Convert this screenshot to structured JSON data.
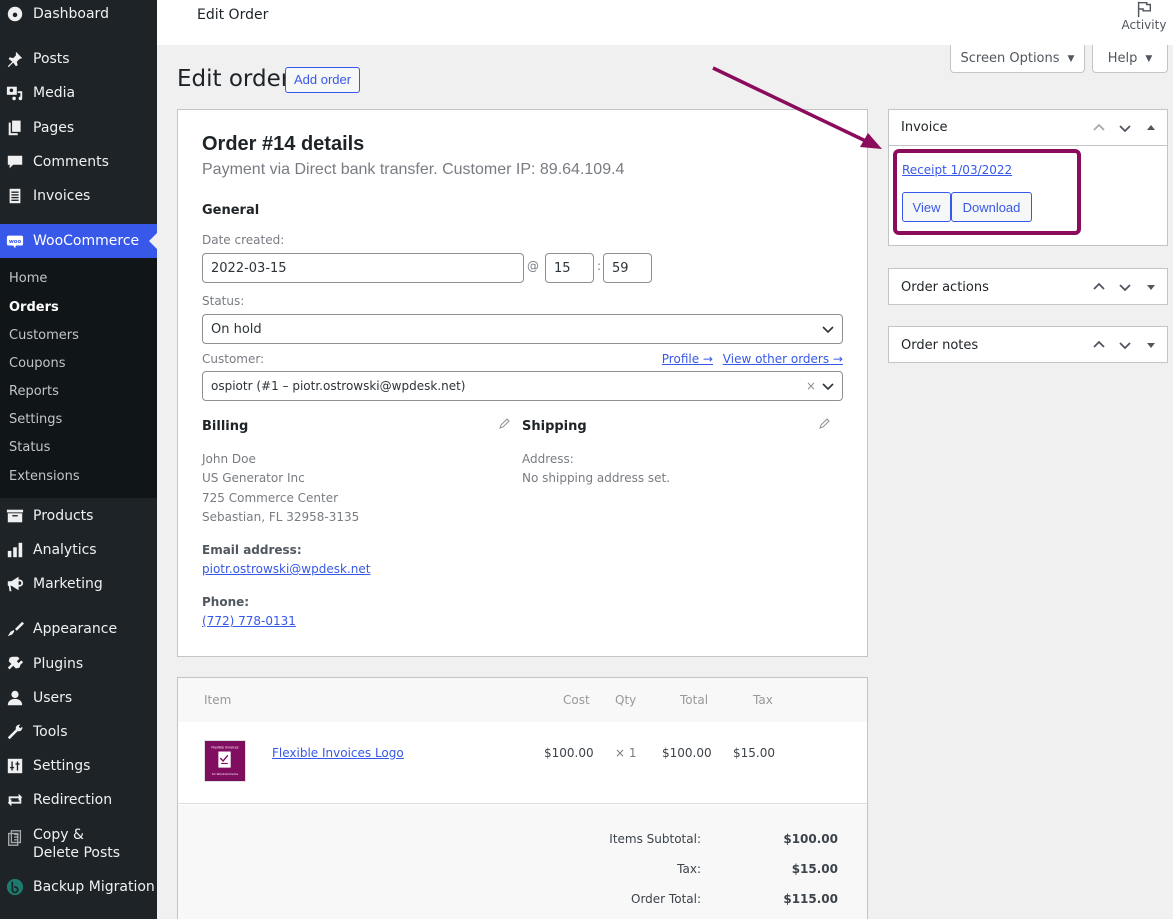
{
  "sidebar": {
    "top_items": [
      {
        "label": "Dashboard",
        "icon": "dashboard-icon"
      },
      {
        "label": "Posts",
        "icon": "pin-icon"
      },
      {
        "label": "Media",
        "icon": "media-icon"
      },
      {
        "label": "Pages",
        "icon": "pages-icon"
      },
      {
        "label": "Comments",
        "icon": "comment-icon"
      },
      {
        "label": "Invoices",
        "icon": "invoice-icon"
      },
      {
        "label": "WooCommerce",
        "icon": "woo-icon"
      }
    ],
    "woo_submenu": [
      {
        "label": "Home"
      },
      {
        "label": "Orders",
        "current": true
      },
      {
        "label": "Customers"
      },
      {
        "label": "Coupons"
      },
      {
        "label": "Reports"
      },
      {
        "label": "Settings"
      },
      {
        "label": "Status"
      },
      {
        "label": "Extensions"
      }
    ],
    "bottom_items": [
      {
        "label": "Products",
        "icon": "archive-icon"
      },
      {
        "label": "Analytics",
        "icon": "bar-chart-icon"
      },
      {
        "label": "Marketing",
        "icon": "megaphone-icon"
      },
      {
        "label": "Appearance",
        "icon": "paintbrush-icon"
      },
      {
        "label": "Plugins",
        "icon": "plug-icon"
      },
      {
        "label": "Users",
        "icon": "user-icon"
      },
      {
        "label": "Tools",
        "icon": "wrench-icon"
      },
      {
        "label": "Settings",
        "icon": "sliders-icon"
      },
      {
        "label": "Redirection",
        "icon": "redirect-icon"
      },
      {
        "label": "Copy & Delete Posts",
        "icon": "copy-icon"
      },
      {
        "label": "Backup Migration",
        "icon": "backup-icon"
      }
    ]
  },
  "topbar": {
    "title": "Edit Order",
    "activity_label": "Activity"
  },
  "screen_options": {
    "screen_options_label": "Screen Options",
    "help_label": "Help",
    "caret": "▼"
  },
  "page": {
    "heading": "Edit order",
    "add_order_label": "Add order"
  },
  "order": {
    "title": "Order #14 details",
    "subtitle": "Payment via Direct bank transfer. Customer IP: 89.64.109.4",
    "general_heading": "General",
    "date_label": "Date created:",
    "date_value": "2022-03-15",
    "at": "@",
    "hour": "15",
    "colon": ":",
    "minute": "59",
    "status_label": "Status:",
    "status_value": "On hold",
    "customer_label": "Customer:",
    "profile_link": "Profile →",
    "other_orders_link": "View other orders →",
    "customer_value": "ospiotr (#1 – piotr.ostrowski@wpdesk.net)",
    "clear_symbol": "×",
    "billing": {
      "heading": "Billing",
      "lines": [
        "John Doe",
        "US Generator Inc",
        "725 Commerce Center",
        "Sebastian, FL 32958-3135"
      ],
      "email_label": "Email address:",
      "email": "piotr.ostrowski@wpdesk.net",
      "phone_label": "Phone:",
      "phone": "(772) 778-0131"
    },
    "shipping": {
      "heading": "Shipping",
      "address_label": "Address:",
      "address_value": "No shipping address set."
    }
  },
  "items": {
    "columns": [
      "Item",
      "Cost",
      "Qty",
      "Total",
      "Tax"
    ],
    "rows": [
      {
        "name": "Flexible Invoices Logo",
        "cost": "$100.00",
        "qty": "× 1",
        "total": "$100.00",
        "tax": "$15.00"
      }
    ],
    "totals": [
      {
        "label": "Items Subtotal:",
        "value": "$100.00"
      },
      {
        "label": "Tax:",
        "value": "$15.00"
      },
      {
        "label": "Order Total:",
        "value": "$115.00"
      }
    ]
  },
  "metaboxes": {
    "invoice": {
      "title": "Invoice",
      "receipt_link": "Receipt 1/03/2022",
      "view_label": "View",
      "download_label": "Download"
    },
    "actions": {
      "title": "Order actions"
    },
    "notes": {
      "title": "Order notes"
    }
  },
  "colors": {
    "accent": "#3858e9",
    "sidebar_bg": "#1d2327",
    "annotation": "#8b0b5c"
  }
}
